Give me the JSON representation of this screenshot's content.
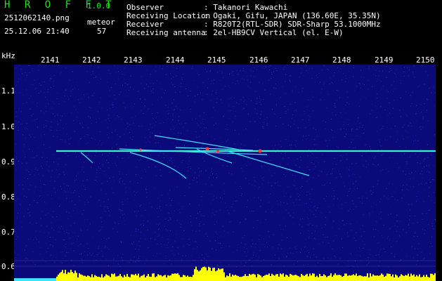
{
  "app": {
    "name": "H R O F F T",
    "version": "1.0.0"
  },
  "file_name": "2512062140.png",
  "date_time": "25.12.06 21:40",
  "meteor": {
    "label": "meteor",
    "count": "57"
  },
  "info": [
    {
      "label": "Observer",
      "value": ": Takanori Kawachi"
    },
    {
      "label": "Receiving Location",
      "value": ": Ogaki, Gifu, JAPAN (136.60E, 35.35N)"
    },
    {
      "label": "Receiver",
      "value": ": R820T2(RTL-SDR) SDR-Sharp 53.1000MHz"
    },
    {
      "label": "Receiving antenna",
      "value": ": 2el-HB9CV Vertical (el. E-W)"
    }
  ],
  "axis": {
    "y_unit": "kHz",
    "y_ticks": [
      "1.1",
      "1.0",
      "0.9",
      "0.8",
      "0.7",
      "0.6"
    ],
    "x_ticks": [
      "2141",
      "2142",
      "2143",
      "2144",
      "2145",
      "2146",
      "2147",
      "2148",
      "2149",
      "2150"
    ]
  },
  "colors": {
    "background": "#000000",
    "logo": "#19e619",
    "spectrogram_bg": "#0a0a7a",
    "noise": "#2840d8",
    "carrier": "#3cf0c8",
    "meteor_trail": "#40e0ff",
    "meteor_head": "#ff3c3c",
    "power_bar": "#ffff00"
  }
}
